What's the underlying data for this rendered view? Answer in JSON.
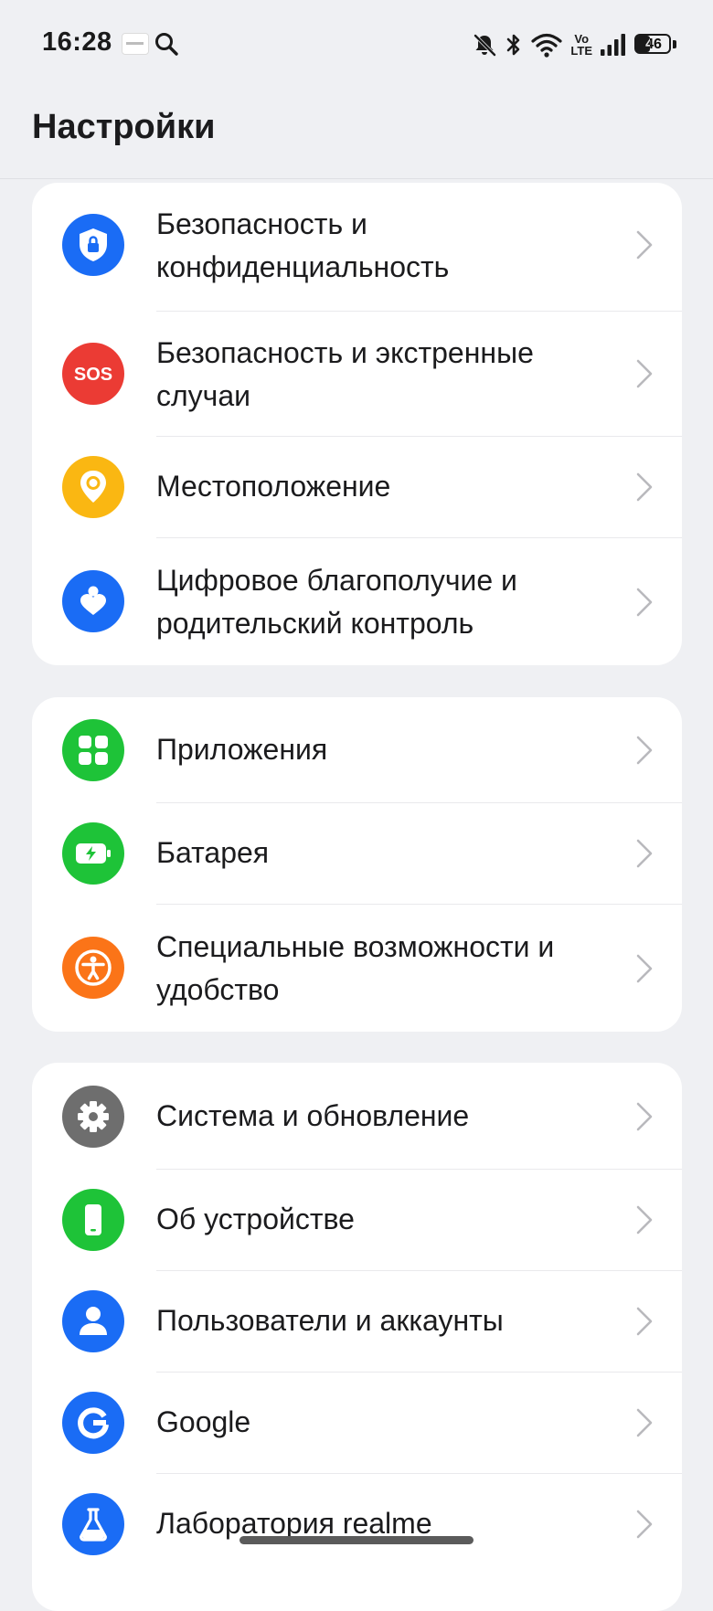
{
  "status_bar": {
    "time": "16:28",
    "icons": [
      "app-notification-icon",
      "search-icon",
      "bell-off-icon",
      "bluetooth-icon",
      "wifi-icon",
      "volte-icon",
      "signal-icon",
      "battery-icon"
    ],
    "volte_top": "Vo",
    "volte_bottom": "LTE",
    "battery_percent": "46",
    "battery_level": 0.46
  },
  "header": {
    "title": "Настройки"
  },
  "groups": [
    {
      "items": [
        {
          "label": "Безопасность и конфиденциальность",
          "icon": "shield-lock-icon",
          "color": "#1a6cf5"
        },
        {
          "label": "Безопасность и экстренные случаи",
          "icon": "sos-icon",
          "icon_text": "SOS",
          "color": "#eb3b34"
        },
        {
          "label": "Местоположение",
          "icon": "location-pin-icon",
          "color": "#fab712"
        },
        {
          "label": "Цифровое благополучие и родительский контроль",
          "icon": "heart-person-icon",
          "color": "#1a6cf5"
        }
      ]
    },
    {
      "items": [
        {
          "label": "Приложения",
          "icon": "apps-grid-icon",
          "color": "#1ec338"
        },
        {
          "label": "Батарея",
          "icon": "battery-charging-icon",
          "color": "#1ec338"
        },
        {
          "label": "Специальные возможности и удобство",
          "icon": "accessibility-icon",
          "color": "#fb7418"
        }
      ]
    },
    {
      "items": [
        {
          "label": "Система и обновление",
          "icon": "gear-icon",
          "color": "#6e6e6e"
        },
        {
          "label": "Об устройстве",
          "icon": "phone-icon",
          "color": "#1ec338"
        },
        {
          "label": "Пользователи и аккаунты",
          "icon": "user-icon",
          "color": "#1a6cf5"
        },
        {
          "label": "Google",
          "icon": "google-icon",
          "color": "#1a6cf5"
        },
        {
          "label": "Лаборатория realme",
          "icon": "lab-flask-icon",
          "color": "#1a6cf5"
        }
      ]
    }
  ]
}
